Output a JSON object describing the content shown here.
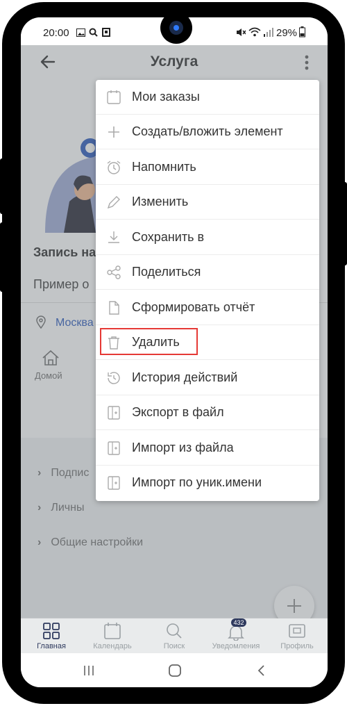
{
  "status_bar": {
    "time": "20:00",
    "battery": "29%"
  },
  "app_bar": {
    "title": "Услуга"
  },
  "content": {
    "heading": "Запись на",
    "description": "Пример о",
    "location": "Москва",
    "quick_action_label": "Домой",
    "settings_items": [
      "Подпис",
      "Личны",
      "Общие настройки"
    ]
  },
  "menu": {
    "items": [
      {
        "label": "Мои заказы",
        "icon": "calendar-icon"
      },
      {
        "label": "Создать/вложить элемент",
        "icon": "plus-icon"
      },
      {
        "label": "Напомнить",
        "icon": "alarm-icon"
      },
      {
        "label": "Изменить",
        "icon": "pencil-icon"
      },
      {
        "label": "Сохранить в",
        "icon": "download-icon"
      },
      {
        "label": "Поделиться",
        "icon": "share-icon"
      },
      {
        "label": "Сформировать отчёт",
        "icon": "document-icon"
      },
      {
        "label": "Удалить",
        "icon": "trash-icon"
      },
      {
        "label": "История действий",
        "icon": "history-icon"
      },
      {
        "label": "Экспорт в файл",
        "icon": "export-icon"
      },
      {
        "label": "Импорт из файла",
        "icon": "import-icon"
      },
      {
        "label": "Импорт по уник.имени",
        "icon": "import-name-icon"
      }
    ],
    "highlighted": "Удалить"
  },
  "bottom_nav": {
    "items": [
      {
        "label": "Главная",
        "icon": "grid-icon",
        "active": true
      },
      {
        "label": "Календарь",
        "icon": "calendar-icon"
      },
      {
        "label": "Поиск",
        "icon": "search-icon"
      },
      {
        "label": "Уведомления",
        "icon": "bell-icon",
        "badge": "432"
      },
      {
        "label": "Профиль",
        "icon": "profile-icon"
      }
    ]
  },
  "colors": {
    "accent": "#1e88e5",
    "highlight": "#e53935",
    "overlay": "#787e82",
    "active_nav": "#2f3a5e"
  }
}
